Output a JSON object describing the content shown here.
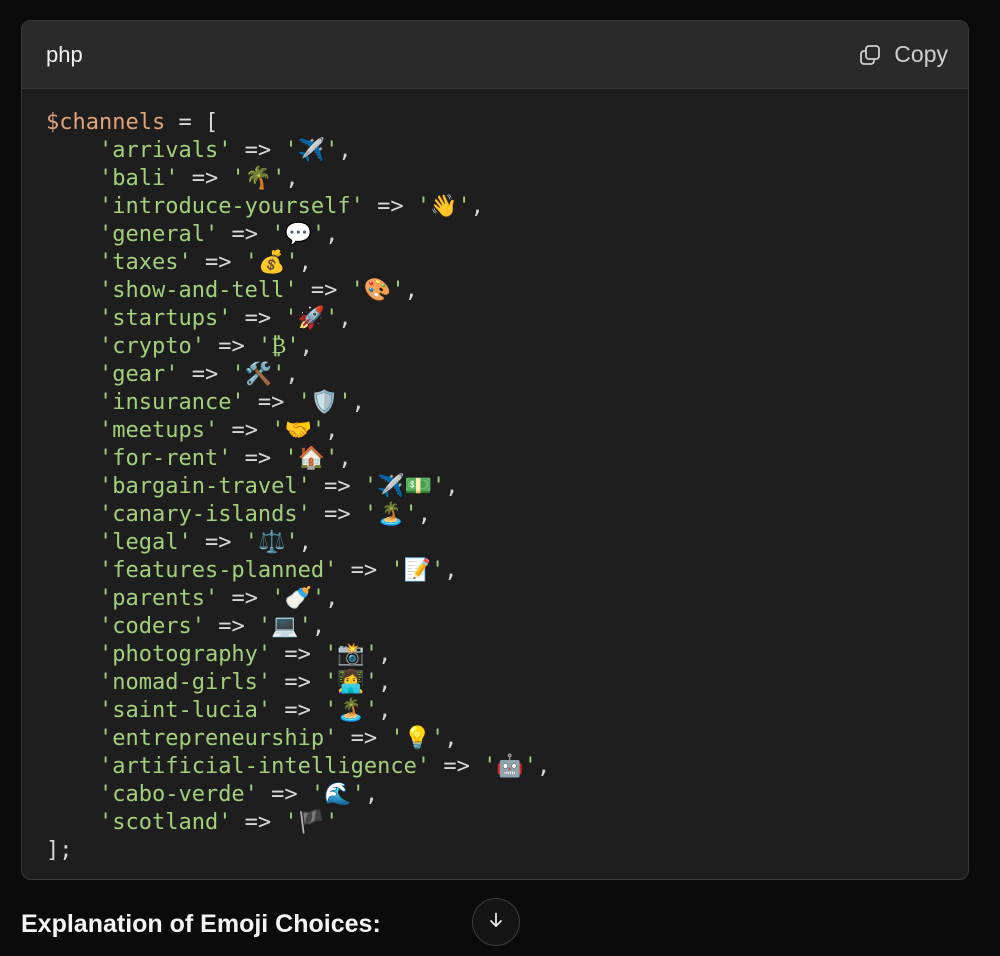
{
  "code_block": {
    "language": "php",
    "copy_label": "Copy",
    "lines": [
      [
        {
          "t": "var",
          "v": "$channels"
        },
        {
          "t": "op",
          "v": " = ["
        }
      ],
      [
        {
          "t": "op",
          "v": "    "
        },
        {
          "t": "str",
          "v": "'arrivals'"
        },
        {
          "t": "op",
          "v": " => "
        },
        {
          "t": "str",
          "v": "'"
        },
        {
          "t": "emoji",
          "v": "✈️"
        },
        {
          "t": "str",
          "v": "'"
        },
        {
          "t": "op",
          "v": ","
        }
      ],
      [
        {
          "t": "op",
          "v": "    "
        },
        {
          "t": "str",
          "v": "'bali'"
        },
        {
          "t": "op",
          "v": " => "
        },
        {
          "t": "str",
          "v": "'"
        },
        {
          "t": "emoji",
          "v": "🌴"
        },
        {
          "t": "str",
          "v": "'"
        },
        {
          "t": "op",
          "v": ","
        }
      ],
      [
        {
          "t": "op",
          "v": "    "
        },
        {
          "t": "str",
          "v": "'introduce-yourself'"
        },
        {
          "t": "op",
          "v": " => "
        },
        {
          "t": "str",
          "v": "'"
        },
        {
          "t": "emoji",
          "v": "👋"
        },
        {
          "t": "str",
          "v": "'"
        },
        {
          "t": "op",
          "v": ","
        }
      ],
      [
        {
          "t": "op",
          "v": "    "
        },
        {
          "t": "str",
          "v": "'general'"
        },
        {
          "t": "op",
          "v": " => "
        },
        {
          "t": "str",
          "v": "'"
        },
        {
          "t": "emoji",
          "v": "💬"
        },
        {
          "t": "str",
          "v": "'"
        },
        {
          "t": "op",
          "v": ","
        }
      ],
      [
        {
          "t": "op",
          "v": "    "
        },
        {
          "t": "str",
          "v": "'taxes'"
        },
        {
          "t": "op",
          "v": " => "
        },
        {
          "t": "str",
          "v": "'"
        },
        {
          "t": "emoji",
          "v": "💰"
        },
        {
          "t": "str",
          "v": "'"
        },
        {
          "t": "op",
          "v": ","
        }
      ],
      [
        {
          "t": "op",
          "v": "    "
        },
        {
          "t": "str",
          "v": "'show-and-tell'"
        },
        {
          "t": "op",
          "v": " => "
        },
        {
          "t": "str",
          "v": "'"
        },
        {
          "t": "emoji",
          "v": "🎨"
        },
        {
          "t": "str",
          "v": "'"
        },
        {
          "t": "op",
          "v": ","
        }
      ],
      [
        {
          "t": "op",
          "v": "    "
        },
        {
          "t": "str",
          "v": "'startups'"
        },
        {
          "t": "op",
          "v": " => "
        },
        {
          "t": "str",
          "v": "'"
        },
        {
          "t": "emoji",
          "v": "🚀"
        },
        {
          "t": "str",
          "v": "'"
        },
        {
          "t": "op",
          "v": ","
        }
      ],
      [
        {
          "t": "op",
          "v": "    "
        },
        {
          "t": "str",
          "v": "'crypto'"
        },
        {
          "t": "op",
          "v": " => "
        },
        {
          "t": "str",
          "v": "'₿'"
        },
        {
          "t": "op",
          "v": ","
        }
      ],
      [
        {
          "t": "op",
          "v": "    "
        },
        {
          "t": "str",
          "v": "'gear'"
        },
        {
          "t": "op",
          "v": " => "
        },
        {
          "t": "str",
          "v": "'"
        },
        {
          "t": "emoji",
          "v": "🛠️"
        },
        {
          "t": "str",
          "v": "'"
        },
        {
          "t": "op",
          "v": ","
        }
      ],
      [
        {
          "t": "op",
          "v": "    "
        },
        {
          "t": "str",
          "v": "'insurance'"
        },
        {
          "t": "op",
          "v": " => "
        },
        {
          "t": "str",
          "v": "'"
        },
        {
          "t": "emoji",
          "v": "🛡️"
        },
        {
          "t": "str",
          "v": "'"
        },
        {
          "t": "op",
          "v": ","
        }
      ],
      [
        {
          "t": "op",
          "v": "    "
        },
        {
          "t": "str",
          "v": "'meetups'"
        },
        {
          "t": "op",
          "v": " => "
        },
        {
          "t": "str",
          "v": "'"
        },
        {
          "t": "emoji",
          "v": "🤝"
        },
        {
          "t": "str",
          "v": "'"
        },
        {
          "t": "op",
          "v": ","
        }
      ],
      [
        {
          "t": "op",
          "v": "    "
        },
        {
          "t": "str",
          "v": "'for-rent'"
        },
        {
          "t": "op",
          "v": " => "
        },
        {
          "t": "str",
          "v": "'"
        },
        {
          "t": "emoji",
          "v": "🏠"
        },
        {
          "t": "str",
          "v": "'"
        },
        {
          "t": "op",
          "v": ","
        }
      ],
      [
        {
          "t": "op",
          "v": "    "
        },
        {
          "t": "str",
          "v": "'bargain-travel'"
        },
        {
          "t": "op",
          "v": " => "
        },
        {
          "t": "str",
          "v": "'"
        },
        {
          "t": "emoji",
          "v": "✈️💵"
        },
        {
          "t": "str",
          "v": "'"
        },
        {
          "t": "op",
          "v": ","
        }
      ],
      [
        {
          "t": "op",
          "v": "    "
        },
        {
          "t": "str",
          "v": "'canary-islands'"
        },
        {
          "t": "op",
          "v": " => "
        },
        {
          "t": "str",
          "v": "'"
        },
        {
          "t": "emoji",
          "v": "🏝️"
        },
        {
          "t": "str",
          "v": "'"
        },
        {
          "t": "op",
          "v": ","
        }
      ],
      [
        {
          "t": "op",
          "v": "    "
        },
        {
          "t": "str",
          "v": "'legal'"
        },
        {
          "t": "op",
          "v": " => "
        },
        {
          "t": "str",
          "v": "'"
        },
        {
          "t": "emoji",
          "v": "⚖️"
        },
        {
          "t": "str",
          "v": "'"
        },
        {
          "t": "op",
          "v": ","
        }
      ],
      [
        {
          "t": "op",
          "v": "    "
        },
        {
          "t": "str",
          "v": "'features-planned'"
        },
        {
          "t": "op",
          "v": " => "
        },
        {
          "t": "str",
          "v": "'"
        },
        {
          "t": "emoji",
          "v": "📝"
        },
        {
          "t": "str",
          "v": "'"
        },
        {
          "t": "op",
          "v": ","
        }
      ],
      [
        {
          "t": "op",
          "v": "    "
        },
        {
          "t": "str",
          "v": "'parents'"
        },
        {
          "t": "op",
          "v": " => "
        },
        {
          "t": "str",
          "v": "'"
        },
        {
          "t": "emoji",
          "v": "🍼"
        },
        {
          "t": "str",
          "v": "'"
        },
        {
          "t": "op",
          "v": ","
        }
      ],
      [
        {
          "t": "op",
          "v": "    "
        },
        {
          "t": "str",
          "v": "'coders'"
        },
        {
          "t": "op",
          "v": " => "
        },
        {
          "t": "str",
          "v": "'"
        },
        {
          "t": "emoji",
          "v": "💻"
        },
        {
          "t": "str",
          "v": "'"
        },
        {
          "t": "op",
          "v": ","
        }
      ],
      [
        {
          "t": "op",
          "v": "    "
        },
        {
          "t": "str",
          "v": "'photography'"
        },
        {
          "t": "op",
          "v": " => "
        },
        {
          "t": "str",
          "v": "'"
        },
        {
          "t": "emoji",
          "v": "📸"
        },
        {
          "t": "str",
          "v": "'"
        },
        {
          "t": "op",
          "v": ","
        }
      ],
      [
        {
          "t": "op",
          "v": "    "
        },
        {
          "t": "str",
          "v": "'nomad-girls'"
        },
        {
          "t": "op",
          "v": " => "
        },
        {
          "t": "str",
          "v": "'"
        },
        {
          "t": "emoji",
          "v": "👩‍💻"
        },
        {
          "t": "str",
          "v": "'"
        },
        {
          "t": "op",
          "v": ","
        }
      ],
      [
        {
          "t": "op",
          "v": "    "
        },
        {
          "t": "str",
          "v": "'saint-lucia'"
        },
        {
          "t": "op",
          "v": " => "
        },
        {
          "t": "str",
          "v": "'"
        },
        {
          "t": "emoji",
          "v": "🏝️"
        },
        {
          "t": "str",
          "v": "'"
        },
        {
          "t": "op",
          "v": ","
        }
      ],
      [
        {
          "t": "op",
          "v": "    "
        },
        {
          "t": "str",
          "v": "'entrepreneurship'"
        },
        {
          "t": "op",
          "v": " => "
        },
        {
          "t": "str",
          "v": "'"
        },
        {
          "t": "emoji",
          "v": "💡"
        },
        {
          "t": "str",
          "v": "'"
        },
        {
          "t": "op",
          "v": ","
        }
      ],
      [
        {
          "t": "op",
          "v": "    "
        },
        {
          "t": "str",
          "v": "'artificial-intelligence'"
        },
        {
          "t": "op",
          "v": " => "
        },
        {
          "t": "str",
          "v": "'"
        },
        {
          "t": "emoji",
          "v": "🤖"
        },
        {
          "t": "str",
          "v": "'"
        },
        {
          "t": "op",
          "v": ","
        }
      ],
      [
        {
          "t": "op",
          "v": "    "
        },
        {
          "t": "str",
          "v": "'cabo-verde'"
        },
        {
          "t": "op",
          "v": " => "
        },
        {
          "t": "str",
          "v": "'"
        },
        {
          "t": "emoji",
          "v": "🌊"
        },
        {
          "t": "str",
          "v": "'"
        },
        {
          "t": "op",
          "v": ","
        }
      ],
      [
        {
          "t": "op",
          "v": "    "
        },
        {
          "t": "str",
          "v": "'scotland'"
        },
        {
          "t": "op",
          "v": " => "
        },
        {
          "t": "str",
          "v": "'"
        },
        {
          "t": "emoji",
          "v": "🏴"
        },
        {
          "t": "str",
          "v": "'"
        }
      ],
      [
        {
          "t": "op",
          "v": "];"
        }
      ]
    ]
  },
  "explanation": {
    "heading": "Explanation of Emoji Choices:"
  },
  "icons": {
    "copy": "copy-icon",
    "scroll_down": "arrow-down-icon"
  },
  "colors": {
    "code_background": "#1e1e1e",
    "header_background": "#2a2a2a",
    "variable": "#e0a37a",
    "string": "#a3d07c"
  }
}
